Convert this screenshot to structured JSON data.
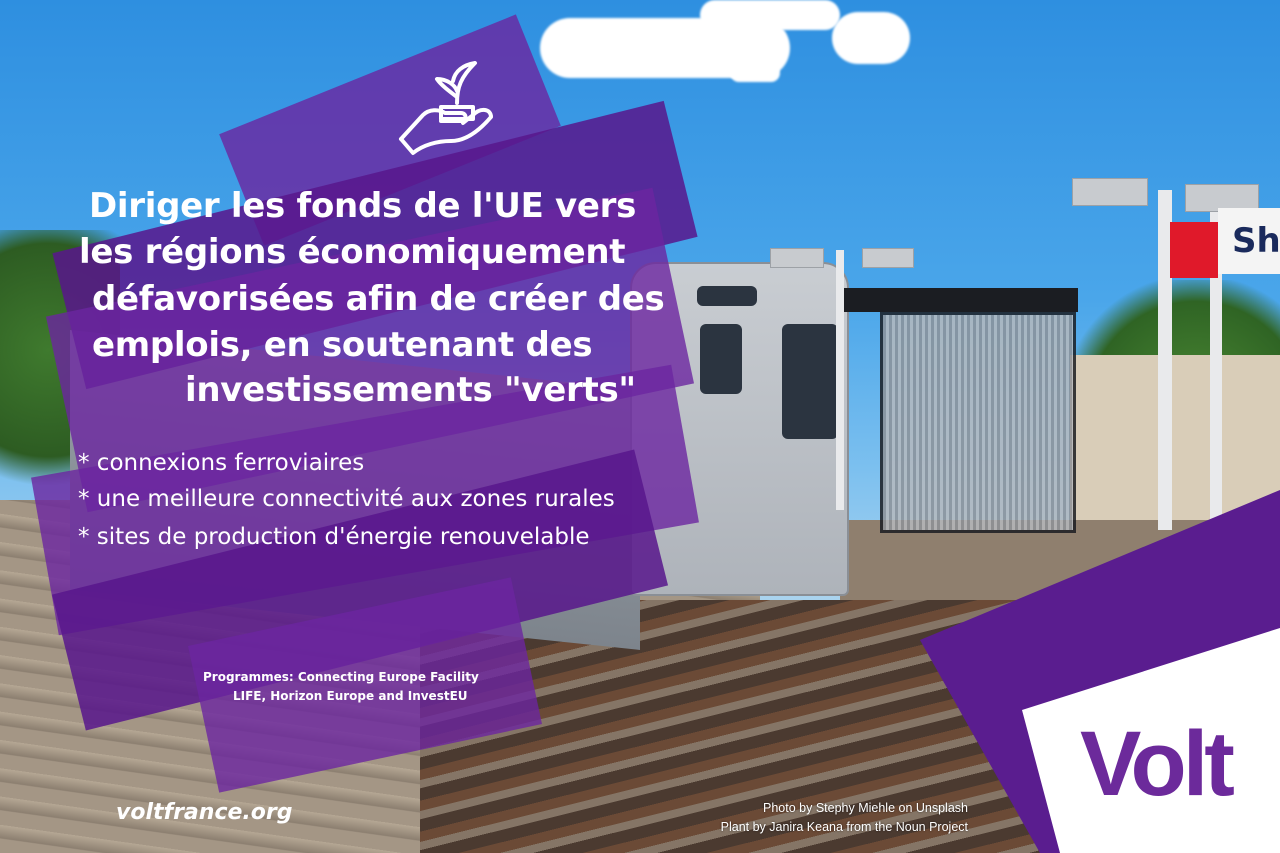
{
  "headline": {
    "lines": [
      "Diriger les fonds de l'UE vers",
      "les régions économiquement",
      "défavorisées afin de créer des",
      "emplois, en soutenant des",
      "investissements \"verts\""
    ]
  },
  "bullets": [
    "* connexions ferroviaires",
    "* une meilleure connectivité aux zones rurales",
    "* sites de production d'énergie renouvelable"
  ],
  "programmes": {
    "line1": "Programmes: Connecting Europe Facility",
    "line2": "LIFE, Horizon Europe and InvestEU"
  },
  "website": "voltfrance.org",
  "credits": {
    "photo": "Photo by Stephy Miehle on Unsplash",
    "plant": "Plant by Janira Keana from the Noun Project"
  },
  "logo": {
    "text": "Volt",
    "color": "#6c2a9b"
  },
  "colors": {
    "overlay_purple": "#6b26a0",
    "brand_purple": "#5a1d8f"
  },
  "icons": [
    "plant-in-hand-icon"
  ]
}
